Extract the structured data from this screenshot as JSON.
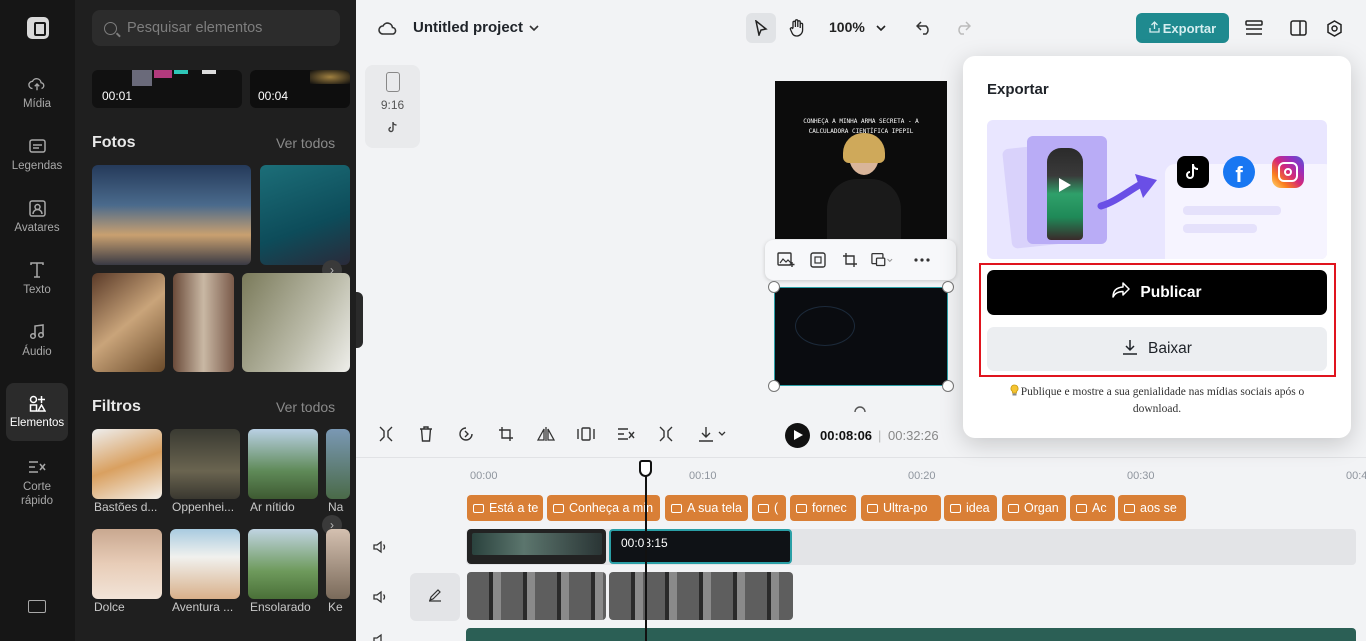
{
  "sidebar": {
    "items": [
      {
        "label": "Mídia",
        "icon": "cloud-upload-icon"
      },
      {
        "label": "Legendas",
        "icon": "captions-icon"
      },
      {
        "label": "Avatares",
        "icon": "avatar-icon"
      },
      {
        "label": "Texto",
        "icon": "text-icon"
      },
      {
        "label": "Áudio",
        "icon": "music-note-icon"
      },
      {
        "label": "Elementos",
        "icon": "elements-icon"
      },
      {
        "label": "Corte rápido",
        "icon": "quick-cut-icon"
      }
    ],
    "active": "Elementos"
  },
  "panel": {
    "search_placeholder": "Pesquisar elementos",
    "video_durations": [
      "00:01",
      "00:04"
    ],
    "photos": {
      "title": "Fotos",
      "see_all": "Ver todos"
    },
    "filters": {
      "title": "Filtros",
      "see_all": "Ver todos",
      "items": [
        "Bastões d...",
        "Oppenhei...",
        "Ar nítido",
        "Na",
        "Dolce",
        "Aventura ...",
        "Ensolarado",
        "Ke"
      ]
    }
  },
  "topbar": {
    "project_title": "Untitled project",
    "zoom": "100%",
    "export_label": "Exportar"
  },
  "canvas": {
    "ratio_label": "9:16",
    "caption_overlay": "CONHEÇA A MINHA ARMA SECRETA - A CALCULADORA CIENTÍFICA IPEPIL"
  },
  "timeline": {
    "current_time": "00:08:06",
    "separator": "|",
    "total_time": "00:32:26",
    "ruler": [
      "00:00",
      "00:10",
      "00:20",
      "00:30",
      "00:4"
    ],
    "captions": [
      "Está a te",
      "Conheça a min",
      "A sua tela",
      "(",
      "fornec",
      "Ultra-po",
      "idea",
      "Organ",
      "Ac",
      "aos se"
    ],
    "clip_timecode": "00:08:15"
  },
  "modal": {
    "title": "Exportar",
    "publish_label": "Publicar",
    "download_label": "Baixar",
    "tip": "Publique e mostre a sua genialidade nas mídias sociais após o download."
  },
  "colors": {
    "accent": "#1f8a8f",
    "caption_orange": "#d97f36",
    "highlight_red": "#e0141e",
    "selection_teal": "#2a9fa6"
  }
}
